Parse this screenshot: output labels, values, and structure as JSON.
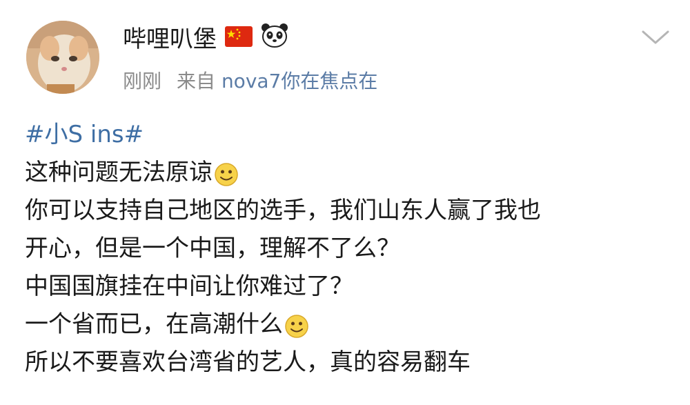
{
  "post": {
    "username": "哔哩叭堡",
    "time": "刚刚",
    "source_prefix": "来自",
    "source_device": "nova7你在焦点在",
    "badges": [
      "china-flag-icon",
      "panda-icon"
    ],
    "hashtag": "#小S ins#",
    "lines": [
      "这种问题无法原谅",
      "你可以支持自己地区的选手，我们山东人赢了我也",
      "开心，但是一个中国，理解不了么？",
      "中国国旗挂在中间让你难过了？",
      "一个省而已，在高潮什么",
      "所以不要喜欢台湾省的艺人，真的容易翻车"
    ]
  },
  "colors": {
    "username": "#1a1a1a",
    "meta": "#8a8a8a",
    "source": "#5b7ca6",
    "hashtag": "#3e6ea4",
    "flag_red": "#de2910",
    "flag_star": "#ffde00"
  }
}
